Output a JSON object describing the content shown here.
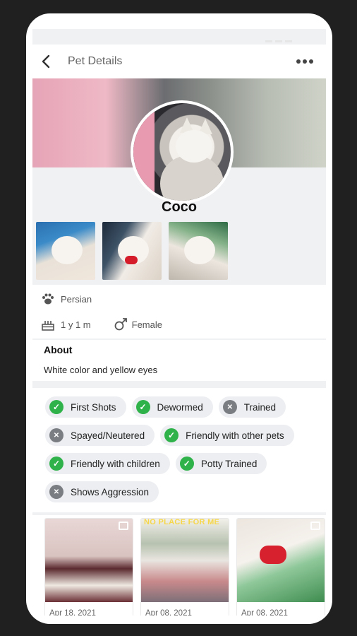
{
  "header": {
    "title": "Pet Details"
  },
  "pet": {
    "name": "Coco",
    "breed": "Persian",
    "age": "1 y 1 m",
    "sex": "Female"
  },
  "about": {
    "heading": "About",
    "text": "White color and yellow eyes"
  },
  "tags": [
    {
      "label": "First Shots",
      "status": "yes"
    },
    {
      "label": "Dewormed",
      "status": "yes"
    },
    {
      "label": "Trained",
      "status": "no"
    },
    {
      "label": "Spayed/Neutered",
      "status": "no"
    },
    {
      "label": "Friendly with other pets",
      "status": "yes"
    },
    {
      "label": "Friendly with children",
      "status": "yes"
    },
    {
      "label": "Potty Trained",
      "status": "yes"
    },
    {
      "label": "Shows Aggression",
      "status": "no"
    }
  ],
  "gallery": [
    {
      "date": "Apr 18, 2021",
      "caption": ""
    },
    {
      "date": "Apr 08, 2021",
      "caption": "NO PLACE FOR ME"
    },
    {
      "date": "Apr 08, 2021",
      "caption": ""
    }
  ],
  "icons": {
    "back": "chevron-left-icon",
    "more": "more-horizontal-icon",
    "breed": "paw-icon",
    "age": "cake-icon",
    "sex": "male-symbol-icon",
    "tag_yes": "check-circle-icon",
    "tag_no": "x-circle-icon"
  },
  "colors": {
    "check": "#2fb24a",
    "cross": "#7a7d82"
  }
}
